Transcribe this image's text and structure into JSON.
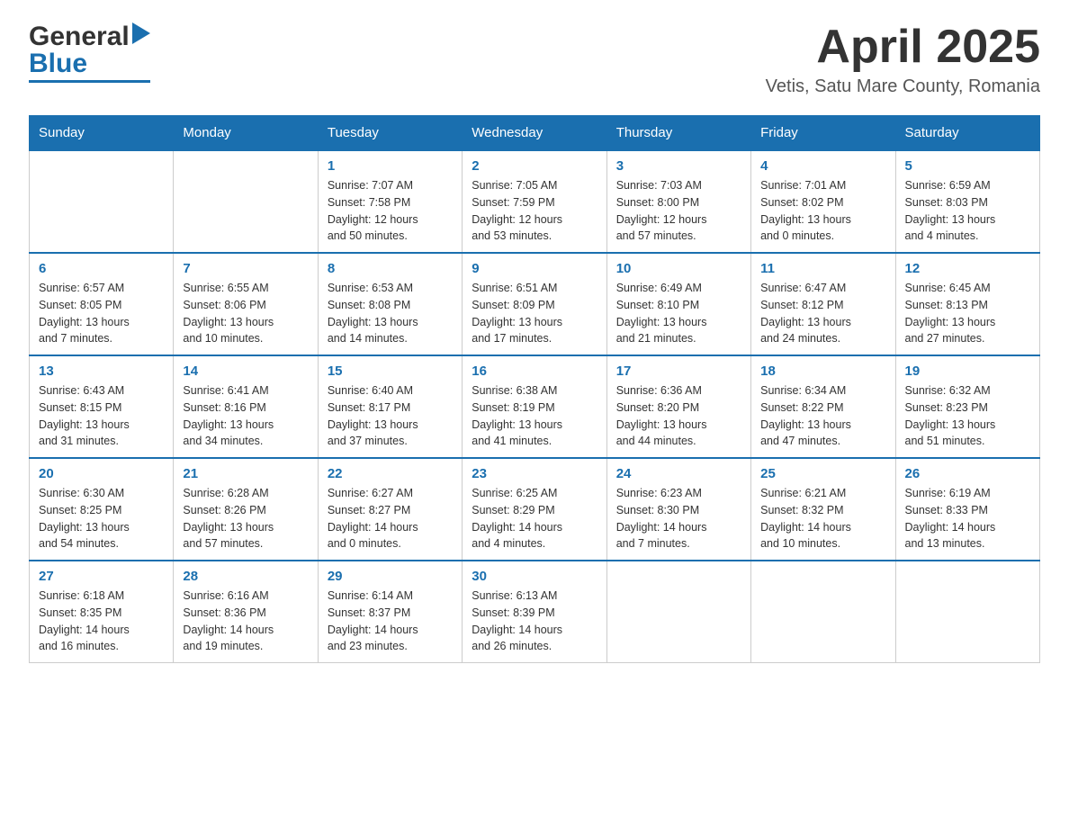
{
  "header": {
    "logo_general": "General",
    "logo_blue": "Blue",
    "month_title": "April 2025",
    "location": "Vetis, Satu Mare County, Romania"
  },
  "days_of_week": [
    "Sunday",
    "Monday",
    "Tuesday",
    "Wednesday",
    "Thursday",
    "Friday",
    "Saturday"
  ],
  "weeks": [
    [
      {
        "day": "",
        "info": ""
      },
      {
        "day": "",
        "info": ""
      },
      {
        "day": "1",
        "info": "Sunrise: 7:07 AM\nSunset: 7:58 PM\nDaylight: 12 hours\nand 50 minutes."
      },
      {
        "day": "2",
        "info": "Sunrise: 7:05 AM\nSunset: 7:59 PM\nDaylight: 12 hours\nand 53 minutes."
      },
      {
        "day": "3",
        "info": "Sunrise: 7:03 AM\nSunset: 8:00 PM\nDaylight: 12 hours\nand 57 minutes."
      },
      {
        "day": "4",
        "info": "Sunrise: 7:01 AM\nSunset: 8:02 PM\nDaylight: 13 hours\nand 0 minutes."
      },
      {
        "day": "5",
        "info": "Sunrise: 6:59 AM\nSunset: 8:03 PM\nDaylight: 13 hours\nand 4 minutes."
      }
    ],
    [
      {
        "day": "6",
        "info": "Sunrise: 6:57 AM\nSunset: 8:05 PM\nDaylight: 13 hours\nand 7 minutes."
      },
      {
        "day": "7",
        "info": "Sunrise: 6:55 AM\nSunset: 8:06 PM\nDaylight: 13 hours\nand 10 minutes."
      },
      {
        "day": "8",
        "info": "Sunrise: 6:53 AM\nSunset: 8:08 PM\nDaylight: 13 hours\nand 14 minutes."
      },
      {
        "day": "9",
        "info": "Sunrise: 6:51 AM\nSunset: 8:09 PM\nDaylight: 13 hours\nand 17 minutes."
      },
      {
        "day": "10",
        "info": "Sunrise: 6:49 AM\nSunset: 8:10 PM\nDaylight: 13 hours\nand 21 minutes."
      },
      {
        "day": "11",
        "info": "Sunrise: 6:47 AM\nSunset: 8:12 PM\nDaylight: 13 hours\nand 24 minutes."
      },
      {
        "day": "12",
        "info": "Sunrise: 6:45 AM\nSunset: 8:13 PM\nDaylight: 13 hours\nand 27 minutes."
      }
    ],
    [
      {
        "day": "13",
        "info": "Sunrise: 6:43 AM\nSunset: 8:15 PM\nDaylight: 13 hours\nand 31 minutes."
      },
      {
        "day": "14",
        "info": "Sunrise: 6:41 AM\nSunset: 8:16 PM\nDaylight: 13 hours\nand 34 minutes."
      },
      {
        "day": "15",
        "info": "Sunrise: 6:40 AM\nSunset: 8:17 PM\nDaylight: 13 hours\nand 37 minutes."
      },
      {
        "day": "16",
        "info": "Sunrise: 6:38 AM\nSunset: 8:19 PM\nDaylight: 13 hours\nand 41 minutes."
      },
      {
        "day": "17",
        "info": "Sunrise: 6:36 AM\nSunset: 8:20 PM\nDaylight: 13 hours\nand 44 minutes."
      },
      {
        "day": "18",
        "info": "Sunrise: 6:34 AM\nSunset: 8:22 PM\nDaylight: 13 hours\nand 47 minutes."
      },
      {
        "day": "19",
        "info": "Sunrise: 6:32 AM\nSunset: 8:23 PM\nDaylight: 13 hours\nand 51 minutes."
      }
    ],
    [
      {
        "day": "20",
        "info": "Sunrise: 6:30 AM\nSunset: 8:25 PM\nDaylight: 13 hours\nand 54 minutes."
      },
      {
        "day": "21",
        "info": "Sunrise: 6:28 AM\nSunset: 8:26 PM\nDaylight: 13 hours\nand 57 minutes."
      },
      {
        "day": "22",
        "info": "Sunrise: 6:27 AM\nSunset: 8:27 PM\nDaylight: 14 hours\nand 0 minutes."
      },
      {
        "day": "23",
        "info": "Sunrise: 6:25 AM\nSunset: 8:29 PM\nDaylight: 14 hours\nand 4 minutes."
      },
      {
        "day": "24",
        "info": "Sunrise: 6:23 AM\nSunset: 8:30 PM\nDaylight: 14 hours\nand 7 minutes."
      },
      {
        "day": "25",
        "info": "Sunrise: 6:21 AM\nSunset: 8:32 PM\nDaylight: 14 hours\nand 10 minutes."
      },
      {
        "day": "26",
        "info": "Sunrise: 6:19 AM\nSunset: 8:33 PM\nDaylight: 14 hours\nand 13 minutes."
      }
    ],
    [
      {
        "day": "27",
        "info": "Sunrise: 6:18 AM\nSunset: 8:35 PM\nDaylight: 14 hours\nand 16 minutes."
      },
      {
        "day": "28",
        "info": "Sunrise: 6:16 AM\nSunset: 8:36 PM\nDaylight: 14 hours\nand 19 minutes."
      },
      {
        "day": "29",
        "info": "Sunrise: 6:14 AM\nSunset: 8:37 PM\nDaylight: 14 hours\nand 23 minutes."
      },
      {
        "day": "30",
        "info": "Sunrise: 6:13 AM\nSunset: 8:39 PM\nDaylight: 14 hours\nand 26 minutes."
      },
      {
        "day": "",
        "info": ""
      },
      {
        "day": "",
        "info": ""
      },
      {
        "day": "",
        "info": ""
      }
    ]
  ]
}
